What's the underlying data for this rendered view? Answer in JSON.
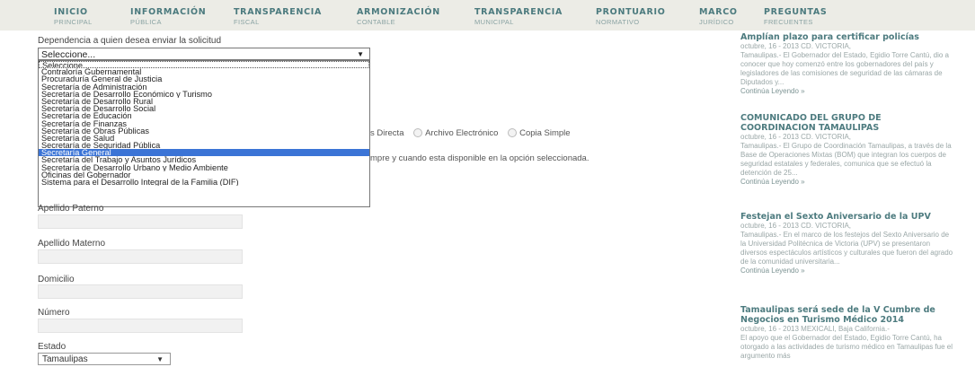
{
  "nav": [
    {
      "main": "INICIO",
      "sub": "PRINCIPAL"
    },
    {
      "main": "INFORMACIÓN",
      "sub": "PÚBLICA"
    },
    {
      "main": "TRANSPARENCIA",
      "sub": "FISCAL"
    },
    {
      "main": "ARMONIZACIÓN",
      "sub": "CONTABLE"
    },
    {
      "main": "TRANSPARENCIA",
      "sub": "MUNICIPAL"
    },
    {
      "main": "PRONTUARIO",
      "sub": "NORMATIVO"
    },
    {
      "main": "MARCO",
      "sub": "JURÍDICO"
    },
    {
      "main": "PREGUNTAS",
      "sub": "FRECUENTES"
    }
  ],
  "form": {
    "dependencia_label": "Dependencia a quien desea enviar la solicitud",
    "dependencia_value": "Seleccione...",
    "options": [
      "Seleccione...",
      "Contraloría Gubernamental",
      "Procuraduría General de Justicia",
      "Secretaría de Administración",
      "Secretaría de Desarrollo Económico y Turismo",
      "Secretaría de Desarrollo Rural",
      "Secretaría de Desarrollo Social",
      "Secretaría de Educación",
      "Secretaría de Finanzas",
      "Secretaría de Obras Públicas",
      "Secretaría de Salud",
      "Secretaría de Seguridad Pública",
      "Secretaría General",
      "Secretaría del Trabajo y Asuntos Jurídicos",
      "Secretaría de Desarrollo Urbano y Medio Ambiente",
      "Oficinas del Gobernador",
      "Sistema para el Desarrollo Integral de la Familia (DIF)"
    ],
    "highlighted_index": 12,
    "delivery_partial": "s Directa",
    "delivery_electronic": "Archivo Electrónico",
    "delivery_copy": "Copia Simple",
    "note_partial": "mpre y cuando esta disponible en la opción seleccionada.",
    "apellido_paterno": "Apellido Paterno",
    "apellido_materno": "Apellido Materno",
    "domicilio": "Domicilio",
    "numero": "Número",
    "estado_label": "Estado",
    "estado_value": "Tamaulipas"
  },
  "news": [
    {
      "title": "Amplían plazo para certificar policías",
      "meta": "octubre, 16 - 2013 CD. VICTORIA,",
      "body": "Tamaulipas.- El Gobernador del Estado, Egidio Torre Cantú, dio a conocer que hoy comenzó entre los gobernadores del país y legisladores de las comisiones de seguridad de las cámaras de Diputados y...",
      "more": "Continúa Leyendo »"
    },
    {
      "title": "COMUNICADO DEL GRUPO DE COORDINACION TAMAULIPAS",
      "meta": "octubre, 16 - 2013 CD. VICTORIA,",
      "body": "Tamaulipas.- El Grupo de Coordinación Tamaulipas, a través de la Base de Operaciones Mixtas (BOM) que integran los cuerpos de seguridad estatales y federales, comunica que se efectuó la detención de 25...",
      "more": "Continúa Leyendo »"
    },
    {
      "title": "Festejan el Sexto Aniversario de la UPV",
      "meta": "octubre, 16 - 2013 CD. VICTORIA,",
      "body": "Tamaulipas.- En el marco de los festejos del Sexto Aniversario de la Universidad Politécnica de Victoria (UPV) se presentaron diversos espectáculos artísticos y culturales que fueron del agrado de la comunidad universitaria...",
      "more": "Continúa Leyendo »"
    },
    {
      "title": "Tamaulipas será sede de la V Cumbre de Negocios en Turismo Médico 2014",
      "meta": "octubre, 16 - 2013 MEXICALI, Baja California.-",
      "body": "El apoyo que el Gobernador del Estado, Egidio Torre Cantú, ha otorgado a las actividades de turismo médico en Tamaulipas fue el argumento más",
      "more": ""
    }
  ]
}
